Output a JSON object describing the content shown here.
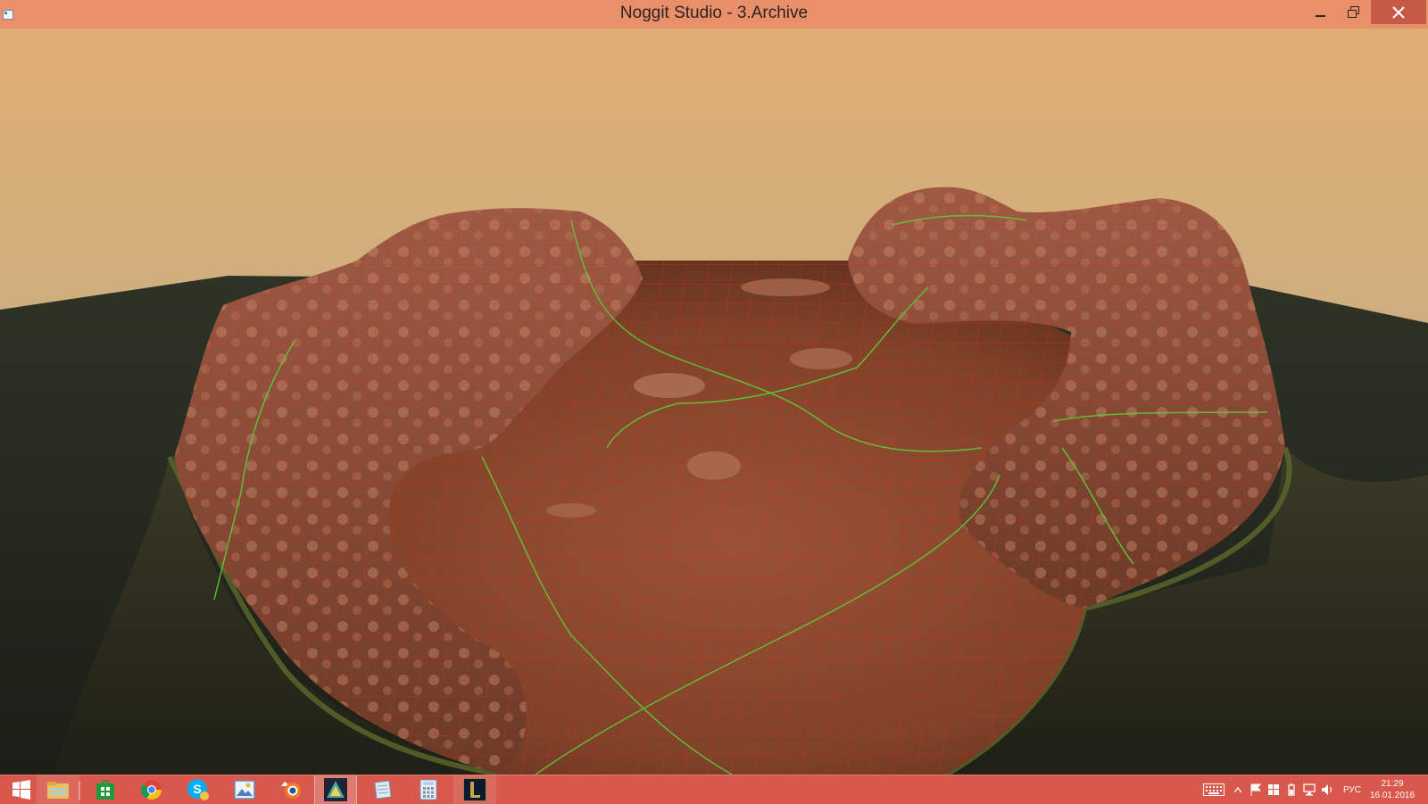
{
  "window": {
    "title": "Noggit Studio - 3.Archive",
    "app_icon": "window-icon",
    "controls": [
      "minimize-icon",
      "restore-icon",
      "close-icon"
    ]
  },
  "viewport": {
    "sky_top": "#dfb27a",
    "sky_horizon": "#c9b08a",
    "terrain_color": "#8a4a2e",
    "grid_line_color": "#d42a1a",
    "chunk_line_color": "#5bd13a"
  },
  "taskbar": {
    "apps": [
      {
        "icon": "windows-start-icon",
        "running": false
      },
      {
        "icon": "file-explorer-icon",
        "running": true
      },
      {
        "icon": "store-icon",
        "running": false
      },
      {
        "icon": "chrome-icon",
        "running": false
      },
      {
        "icon": "skype-icon",
        "running": false
      },
      {
        "icon": "image-viewer-icon",
        "running": false
      },
      {
        "icon": "blender-icon",
        "running": false
      },
      {
        "icon": "noggit-icon",
        "running": true
      },
      {
        "icon": "notepad-icon",
        "running": false
      },
      {
        "icon": "calculator-icon",
        "running": false
      },
      {
        "icon": "league-launcher-icon",
        "running": true
      }
    ],
    "tray": {
      "icons": [
        "keyboard-icon",
        "show-hidden-icon",
        "flag-icon",
        "windows-icon",
        "power-icon",
        "network-icon",
        "volume-icon"
      ],
      "language": "РУС",
      "time": "21:29",
      "date": "16.01.2016"
    }
  }
}
